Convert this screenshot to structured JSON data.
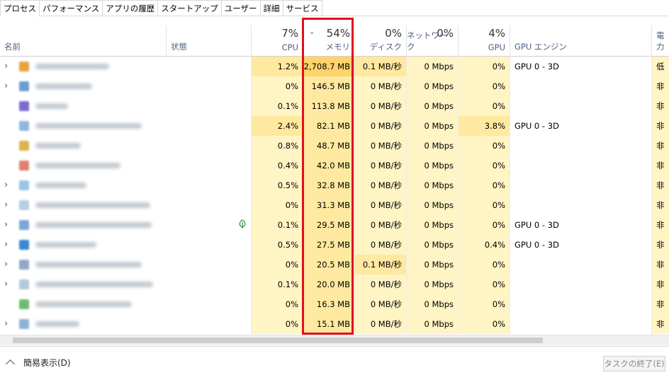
{
  "tabs": [
    "プロセス",
    "パフォーマンス",
    "アプリの履歴",
    "スタートアップ",
    "ユーザー",
    "詳細",
    "サービス"
  ],
  "columns": {
    "name": {
      "label": "名前"
    },
    "status": {
      "label": "状態"
    },
    "cpu": {
      "pct": "7%",
      "label": "CPU"
    },
    "memory": {
      "pct": "54%",
      "label": "メモリ"
    },
    "disk": {
      "pct": "0%",
      "label": "ディスク"
    },
    "network": {
      "pct": "0%",
      "label": "ネットワーク"
    },
    "gpu": {
      "pct": "4%",
      "label": "GPU"
    },
    "gpu_engine": {
      "label": "GPU エンジン"
    },
    "power": {
      "label": "電力"
    }
  },
  "rows": [
    {
      "expand": true,
      "icon_color": "#e8a33c",
      "name_width": 104,
      "cpu": "1.2%",
      "mem": "2,708.7 MB",
      "disk": "0.1 MB/秒",
      "net": "0 Mbps",
      "gpu": "0%",
      "engine": "GPU 0 - 3D",
      "power": "低"
    },
    {
      "expand": true,
      "icon_color": "#6a9bd1",
      "name_width": 80,
      "cpu": "0%",
      "mem": "146.5 MB",
      "disk": "0 MB/秒",
      "net": "0 Mbps",
      "gpu": "0%",
      "engine": "",
      "power": "非"
    },
    {
      "expand": false,
      "icon_color": "#7b6ad1",
      "name_width": 46,
      "cpu": "0.1%",
      "mem": "113.8 MB",
      "disk": "0 MB/秒",
      "net": "0 Mbps",
      "gpu": "0%",
      "engine": "",
      "power": "非"
    },
    {
      "expand": false,
      "icon_color": "#8fb6df",
      "name_width": 150,
      "cpu": "2.4%",
      "mem": "82.1 MB",
      "disk": "0 MB/秒",
      "net": "0 Mbps",
      "gpu": "3.8%",
      "engine": "GPU 0 - 3D",
      "power": "非"
    },
    {
      "expand": false,
      "icon_color": "#d9b44a",
      "name_width": 64,
      "cpu": "0.8%",
      "mem": "48.7 MB",
      "disk": "0 MB/秒",
      "net": "0 Mbps",
      "gpu": "0%",
      "engine": "",
      "power": "非"
    },
    {
      "expand": false,
      "icon_color": "#e07f6a",
      "name_width": 120,
      "cpu": "0.4%",
      "mem": "42.0 MB",
      "disk": "0 MB/秒",
      "net": "0 Mbps",
      "gpu": "0%",
      "engine": "",
      "power": "非"
    },
    {
      "expand": true,
      "icon_color": "#9cc3ea",
      "name_width": 72,
      "cpu": "0.5%",
      "mem": "32.8 MB",
      "disk": "0 MB/秒",
      "net": "0 Mbps",
      "gpu": "0%",
      "engine": "",
      "power": "非"
    },
    {
      "expand": true,
      "icon_color": "#b8cde6",
      "name_width": 162,
      "cpu": "0%",
      "mem": "31.3 MB",
      "disk": "0 MB/秒",
      "net": "0 Mbps",
      "gpu": "0%",
      "engine": "",
      "power": "非"
    },
    {
      "expand": true,
      "icon_color": "#7aa6d8",
      "name_width": 164,
      "leaf": true,
      "cpu": "0.1%",
      "mem": "29.5 MB",
      "disk": "0 MB/秒",
      "net": "0 Mbps",
      "gpu": "0%",
      "engine": "GPU 0 - 3D",
      "power": "非"
    },
    {
      "expand": true,
      "icon_color": "#3c86d4",
      "name_width": 86,
      "cpu": "0.5%",
      "mem": "27.5 MB",
      "disk": "0 MB/秒",
      "net": "0 Mbps",
      "gpu": "0.4%",
      "engine": "GPU 0 - 3D",
      "power": "非"
    },
    {
      "expand": true,
      "icon_color": "#8fa9c9",
      "name_width": 150,
      "cpu": "0%",
      "mem": "20.5 MB",
      "disk": "0.1 MB/秒",
      "net": "0 Mbps",
      "gpu": "0%",
      "engine": "",
      "power": "非"
    },
    {
      "expand": true,
      "icon_color": "#b3c7de",
      "name_width": 166,
      "cpu": "0.1%",
      "mem": "20.0 MB",
      "disk": "0 MB/秒",
      "net": "0 Mbps",
      "gpu": "0%",
      "engine": "",
      "power": "非"
    },
    {
      "expand": false,
      "icon_color": "#6fba6f",
      "name_width": 136,
      "cpu": "0%",
      "mem": "16.3 MB",
      "disk": "0 MB/秒",
      "net": "0 Mbps",
      "gpu": "0%",
      "engine": "",
      "power": "非"
    },
    {
      "expand": true,
      "icon_color": "#8fb1d8",
      "name_width": 62,
      "cpu": "0%",
      "mem": "15.1 MB",
      "disk": "0 MB/秒",
      "net": "0 Mbps",
      "gpu": "0%",
      "engine": "",
      "power": "非"
    }
  ],
  "footer": {
    "simple_view": "簡易表示(D)",
    "end_task": "タスクの終了(E)"
  },
  "colors": {
    "cell_light": "#fff4c4",
    "cell_mid": "#ffe9a0",
    "cell_hot": "#ffd36b",
    "highlight_box": "#e0101e"
  }
}
